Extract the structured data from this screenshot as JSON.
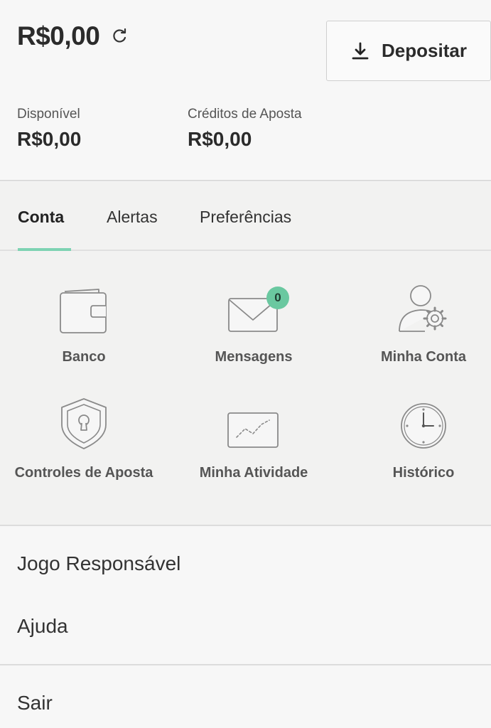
{
  "balance": {
    "total": "R$0,00"
  },
  "deposit": {
    "label": "Depositar"
  },
  "available": {
    "caption": "Disponível",
    "value": "R$0,00"
  },
  "credits": {
    "caption": "Créditos de Aposta",
    "value": "R$0,00"
  },
  "tabs": [
    {
      "label": "Conta",
      "active": true
    },
    {
      "label": "Alertas",
      "active": false
    },
    {
      "label": "Preferências",
      "active": false
    }
  ],
  "tiles": [
    {
      "label": "Banco",
      "icon": "wallet-icon"
    },
    {
      "label": "Mensagens",
      "icon": "envelope-icon",
      "badge": "0"
    },
    {
      "label": "Minha Conta",
      "icon": "user-gear-icon"
    },
    {
      "label": "Controles de Aposta",
      "icon": "shield-lock-icon"
    },
    {
      "label": "Minha Atividade",
      "icon": "activity-chart-icon"
    },
    {
      "label": "Histórico",
      "icon": "clock-icon"
    }
  ],
  "links": [
    {
      "label": "Jogo Responsável"
    },
    {
      "label": "Ajuda"
    },
    {
      "label": "Sair"
    }
  ],
  "colors": {
    "accent": "#7ed3b3",
    "badge": "#6ac8a0",
    "icon_stroke": "#8a8a8a"
  }
}
